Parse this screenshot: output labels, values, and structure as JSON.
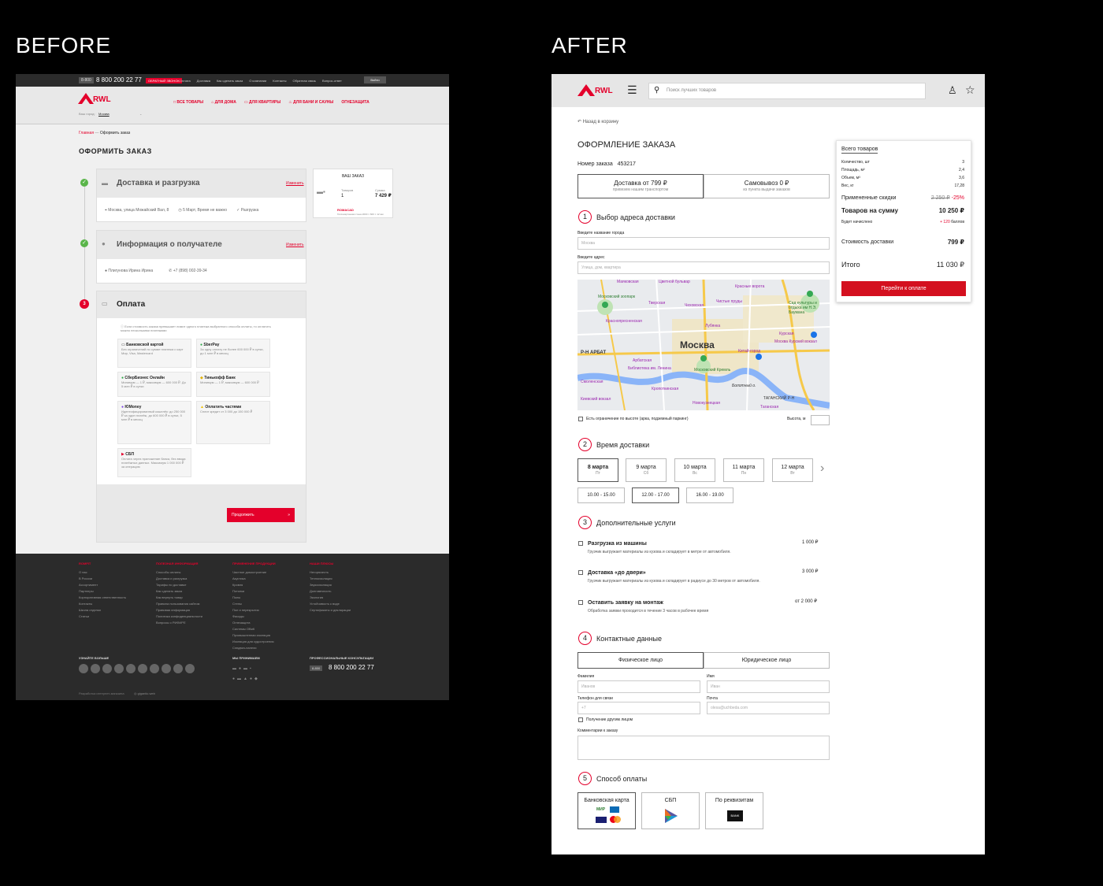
{
  "labels": {
    "before": "BEFORE",
    "after": "AFTER"
  },
  "colors": {
    "accent": "#e4002b",
    "dark_footer": "#2b2b2b"
  },
  "before": {
    "topbar": {
      "badge": "8-800",
      "phone": "8 800 200 22 77",
      "callback": "ОБРАТНЫЙ ЗВОНОК",
      "links": [
        "Оплата",
        "Доставка",
        "Как сделать заказ",
        "О компании",
        "Контакты",
        "Обратная связь",
        "Вопрос-ответ"
      ],
      "login": "Войти"
    },
    "header": {
      "logo": "RWL",
      "city_label": "Ваш город:",
      "city": "Москва",
      "nav": [
        "ВСЕ ТОВАРЫ",
        "ДЛЯ ДОМА",
        "ДЛЯ КВАРТИРЫ",
        "ДЛЯ БАНИ И САУНЫ",
        "ОГНЕЗАЩИТА"
      ]
    },
    "breadcrumb": [
      "Главная",
      "Оформить заказ"
    ],
    "title": "ОФОРМИТЬ ЗАКАЗ",
    "step1": {
      "title": "Доставка и разгрузка",
      "edit": "Изменить",
      "address": "Москва, улица Можайский Вал, 8",
      "date": "5 Март, Время не важно",
      "unload": "Разгрузка"
    },
    "step2": {
      "title": "Информация о получателе",
      "edit": "Изменить",
      "name": "Плигунова Ирина Ирина",
      "phone": "+7 (898) 002-39-34"
    },
    "step3": {
      "num": "3",
      "title": "Оплата",
      "notice": "Если стоимость заказа превышает лимит одного платежа выбранного способа оплаты, то оплатить можно несколькими платежами",
      "methods": [
        {
          "name": "Банковской картой",
          "desc": "Без ограничений по сумме платежа с карт Мир, Visa, Mastercard"
        },
        {
          "name": "SberPay",
          "desc": "За одну оплату не более 600 000 ₽ в сутки, до 1 млн ₽ в месяц"
        },
        {
          "name": "СберБизнес Онлайн",
          "desc": "Минимум — 1 ₽, максимум — 600 000 ₽. До 5 млн ₽ в сутки"
        },
        {
          "name": "Тинькофф Банк",
          "desc": "Минимум — 1 ₽, максимум — 600 000 ₽"
        },
        {
          "name": "ЮMoney",
          "desc": "Идентифицированный кошелёк: до 250 000 ₽ за один платёж, до 600 000 ₽ в сутки, 5 млн ₽ в месяц"
        },
        {
          "name": "Оплатить частями",
          "desc": "Сплит кредит от 3 000 до 150 000 ₽"
        },
        {
          "name": "СБП",
          "desc": "Оплата через приложение банка, без ввода платёжных данных. Максимум 1 000 000 ₽ за операцию"
        }
      ],
      "cta": "Продолжить"
    },
    "order": {
      "title": "ВАШ ЗАКАЗ",
      "items_label": "Товаров",
      "items": "1",
      "sum_label": "Сумма",
      "sum": "7 429 ₽",
      "brand": "ROMACAD",
      "brand_desc": "Гипсокартонная стена 2000 × 600 × 12 мм"
    },
    "footer": {
      "cols": [
        {
          "title": "ROMFIT",
          "items": [
            "О нас",
            "В России",
            "Ассортимент",
            "Партнеры",
            "Корпоративная ответственность",
            "Контакты",
            "Школа отделки",
            "Статьи"
          ]
        },
        {
          "title": "ПОЛЕЗНАЯ ИНФОРМАЦИЯ",
          "items": [
            "Способы оплаты",
            "Доставка и разгрузка",
            "Тарифы по доставке",
            "Как сделать заказ",
            "Как вернуть товар",
            "Правила пользования сайтом",
            "Правовая информация",
            "Политика конфиденциальности",
            "Вопросы о РИФИРЕ"
          ]
        },
        {
          "title": "ПРИМЕНЕНИЕ ПРОДУКЦИИ",
          "items": [
            "Частное домостроение",
            "Акустика",
            "Кровля",
            "Потолки",
            "Полы",
            "Стены",
            "Пол и перекрытия",
            "Фасады",
            "Огнезащита",
            "Системы ОВиК",
            "Промышленная изоляция",
            "Изоляция для судостроения",
            "Сэндвич-панели"
          ]
        },
        {
          "title": "НАШИ ПЛЮСЫ",
          "items": [
            "Негорючесть",
            "Теплоизоляция",
            "Звукоизоляция",
            "Долговечность",
            "Экология",
            "Устойчивость к воде",
            "Сертификаты и декларации"
          ]
        }
      ],
      "social_title": "УЗНАЙТЕ БОЛЬШЕ",
      "pay_title": "МЫ ПРИНИМАЕМ",
      "consult_title": "ПРОФЕССИОНАЛЬНЫЕ КОНСУЛЬТАЦИИ",
      "phone": "8 800 200 22 77",
      "dev": "Разработка интернет-магазина",
      "studio": "gigantic.web"
    }
  },
  "after": {
    "header": {
      "logo": "RWL",
      "search_placeholder": "Поиск лучших товаров"
    },
    "back": "Назад в корзину",
    "title": "ОФОРМЛЕНИЕ ЗАКАЗА",
    "order_no_label": "Номер заказа",
    "order_no": "453217",
    "delivery": [
      {
        "title": "Доставка от 799 ₽",
        "sub": "привезем нашим транспортом"
      },
      {
        "title": "Самовывоз 0 ₽",
        "sub": "из пункта выдачи заказов"
      }
    ],
    "s1": {
      "num": "1",
      "title": "Выбор адреса доставки",
      "city_label": "Введите название города",
      "city_ph": "Москва",
      "addr_label": "Введите адрес",
      "addr_ph": "Улица, дом, квартира",
      "height_limit": "Есть ограничение по высоте (арка, подземный паркинг)",
      "height_label": "Высота, м"
    },
    "map": {
      "center": "Москва",
      "labels": [
        "Маяковская",
        "Цветной бульвар",
        "Красные ворота",
        "Московский зоопарк",
        "Тверская",
        "Чеховская",
        "Чистые пруды",
        "Сад культуры и отдыха им Н.Э. Баумана",
        "Краснопресненская",
        "Лубянка",
        "Р-Н АРБАТ",
        "Арбатская",
        "Курская",
        "Москва Курский вокзал",
        "Библиотека им. Ленина",
        "Московский Кремль",
        "Китай-город",
        "Смоленская",
        "Кропоткинская",
        "Болотный о.",
        "Киевский вокзал",
        "Новокузнецкая",
        "Таганская",
        "ТАГАНСКИЙ Р-Н"
      ]
    },
    "s2": {
      "num": "2",
      "title": "Время доставки",
      "dates": [
        {
          "d": "8 марта",
          "w": "Пт"
        },
        {
          "d": "9 марта",
          "w": "Сб"
        },
        {
          "d": "10 марта",
          "w": "Вс"
        },
        {
          "d": "11 марта",
          "w": "Пн"
        },
        {
          "d": "12 марта",
          "w": "Вт"
        }
      ],
      "times": [
        "10.00 - 15.00",
        "12.00 - 17.00",
        "16.00 - 19.00"
      ]
    },
    "s3": {
      "num": "3",
      "title": "Дополнительные услуги",
      "items": [
        {
          "name": "Разгрузка из машины",
          "price": "1 000 ₽",
          "desc": "Грузчик выгружает материалы из кузова и складирует в метре от автомобиля."
        },
        {
          "name": "Доставка «до двери»",
          "price": "3 000 ₽",
          "desc": "Грузчик выгружает материалы из кузова и складирует в радиусе до 30 метров от автомобиля."
        },
        {
          "name": "Оставить заявку на монтаж",
          "price": "от 2 000 ₽",
          "desc": "Обработка заявки проходится в течение 3 часов в рабочее время"
        }
      ]
    },
    "s4": {
      "num": "4",
      "title": "Контактные данные",
      "tabs": [
        "Физическое лицо",
        "Юридическое лицо"
      ],
      "surname_label": "Фамилия",
      "surname_ph": "Иванов",
      "name_label": "Имя",
      "name_ph": "Иван",
      "phone_label": "Телефон для связи",
      "phone_ph": "+7",
      "email_label": "Почта",
      "email_ph": "olesa@uchbeda.com",
      "other": "Получение другим лицом",
      "comment_label": "Комментарии к заказу"
    },
    "s5": {
      "num": "5",
      "title": "Способ оплаты",
      "methods": [
        "Банковская карта",
        "СБП",
        "По реквизитам"
      ],
      "bank_mark": "BANK"
    },
    "summary": {
      "all": "Всего товаров",
      "rows": [
        [
          "Количество, шт",
          "3"
        ],
        [
          "Площадь, м²",
          "2,4"
        ],
        [
          "Объем, м³",
          "3,6"
        ],
        [
          "Вес, кг",
          "17,28"
        ]
      ],
      "discount_label": "Примененные скидки",
      "old": "2 250 ₽",
      "pct": "-25%",
      "goods_label": "Товаров на сумму",
      "goods": "10 250 ₽",
      "bonus_label": "Будет начислено",
      "bonus_val": "+ 120",
      "bonus_unit": "баллов",
      "delivery_label": "Стоимость доставки",
      "delivery": "799 ₽",
      "total_label": "Итого",
      "total": "11 030 ₽",
      "cta": "Перейти к оплате"
    }
  }
}
